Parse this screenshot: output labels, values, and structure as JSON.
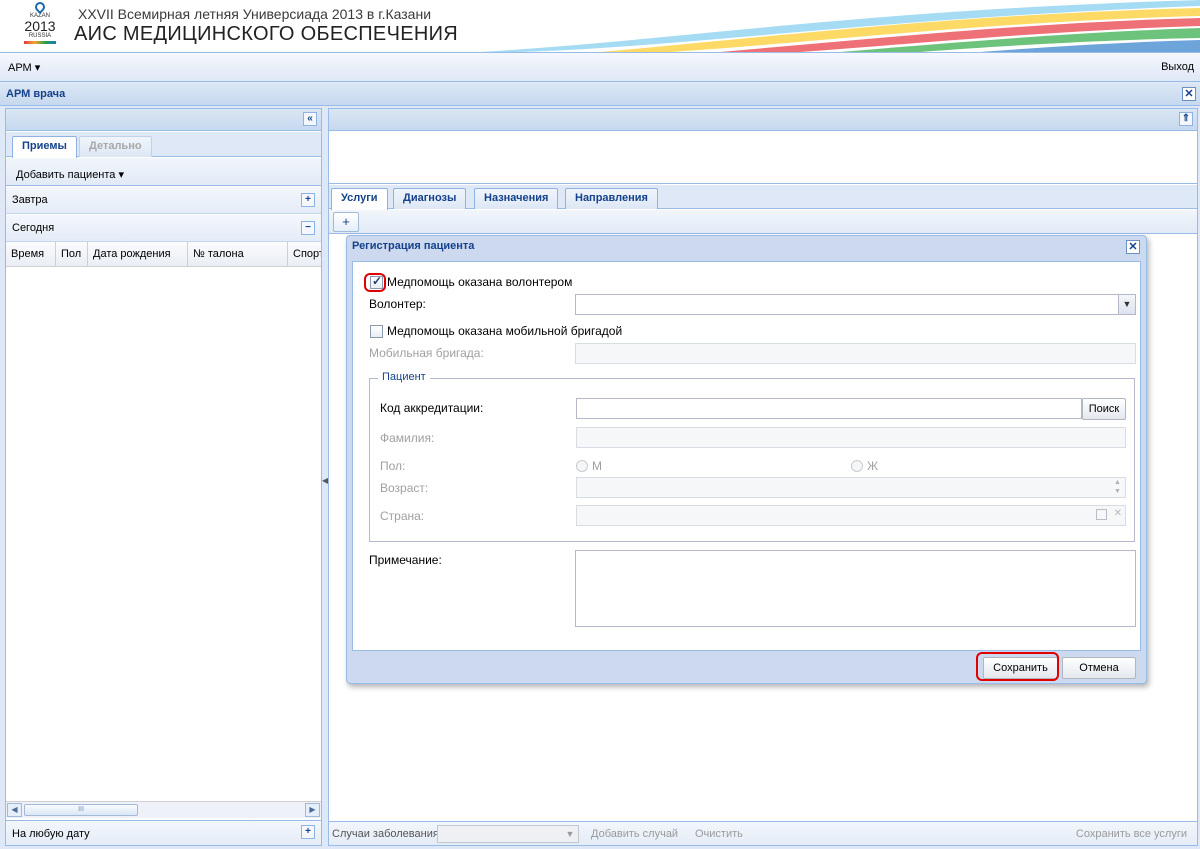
{
  "header": {
    "logo_text": [
      "KAZAN",
      "2013",
      "RUSSIA"
    ],
    "subtitle": "XXVII Всемирная летняя Универсиада 2013 в г.Казани",
    "title": "АИС МЕДИЦИНСКОГО ОБЕСПЕЧЕНИЯ"
  },
  "menubar": {
    "arm_label": "АРМ ▾",
    "exit_label": "Выход"
  },
  "panel": {
    "title": "АРМ врача",
    "close_glyph": "✕"
  },
  "left": {
    "collapse_glyph": "«",
    "tabs": [
      {
        "label": "Приемы",
        "active": true
      },
      {
        "label": "Детально",
        "active": false
      }
    ],
    "add_patient_label": "Добавить пациента ▾",
    "groups": [
      {
        "label": "Завтра",
        "toggle": "+"
      },
      {
        "label": "Сегодня",
        "toggle": "−"
      }
    ],
    "columns": [
      "Время",
      "Пол",
      "Дата рождения",
      "№ талона",
      "Спорт"
    ],
    "footer_label": "На любую дату",
    "footer_toggle": "+",
    "scroll_thumb": "III",
    "scroll_left": "◀",
    "scroll_right": "▶"
  },
  "right": {
    "collapse_glyph": "⇑",
    "tabs": [
      {
        "label": "Услуги",
        "active": true
      },
      {
        "label": "Диагнозы",
        "active": false
      },
      {
        "label": "Назначения",
        "active": false
      },
      {
        "label": "Направления",
        "active": false
      }
    ],
    "add_glyph": "+",
    "footer": {
      "cases_label": "Случаи заболевания",
      "add_case_label": "Добавить случай",
      "clear_label": "Очистить",
      "save_all_label": "Сохранить все услуги"
    }
  },
  "dialog": {
    "title": "Регистрация пациента",
    "close_glyph": "✕",
    "volunteer_check": {
      "label": "Медпомощь оказана волонтером",
      "checked": true
    },
    "volunteer_label": "Волонтер:",
    "volunteer_value": "",
    "mobile_check": {
      "label": "Медпомощь оказана мобильной бригадой",
      "checked": false
    },
    "mobile_label": "Мобильная бригада:",
    "patient_legend": "Пациент",
    "accreditation_label": "Код аккредитации:",
    "search_button": "Поиск",
    "surname_label": "Фамилия:",
    "sex_label": "Пол:",
    "sex_options": [
      "М",
      "Ж"
    ],
    "age_label": "Возраст:",
    "country_label": "Страна:",
    "note_label": "Примечание:",
    "save_button": "Сохранить",
    "cancel_button": "Отмена"
  },
  "colors": {
    "accent": "#15428b",
    "border": "#99bbe8",
    "highlight": "#e00000"
  }
}
